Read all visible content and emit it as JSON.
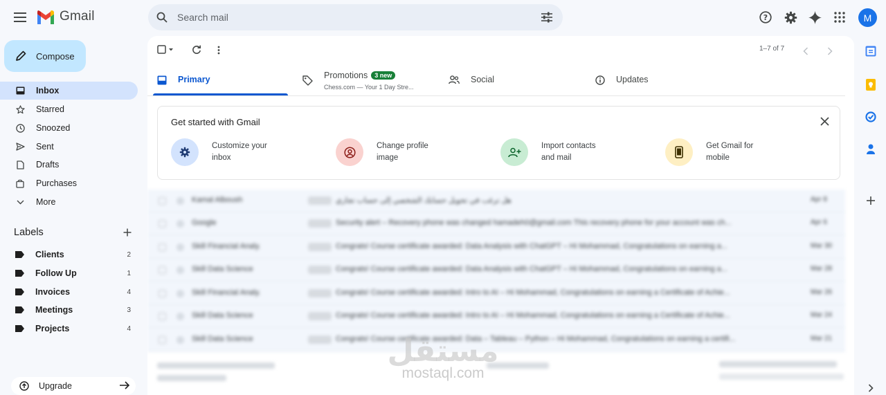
{
  "app": {
    "name": "Gmail",
    "avatar_letter": "M"
  },
  "search": {
    "placeholder": "Search mail"
  },
  "compose": {
    "label": "Compose"
  },
  "nav": [
    {
      "label": "Inbox",
      "icon": "inbox-icon",
      "active": true
    },
    {
      "label": "Starred",
      "icon": "star-icon"
    },
    {
      "label": "Snoozed",
      "icon": "clock-icon"
    },
    {
      "label": "Sent",
      "icon": "send-icon"
    },
    {
      "label": "Drafts",
      "icon": "draft-icon"
    },
    {
      "label": "Purchases",
      "icon": "shopping-bag-icon"
    },
    {
      "label": "More",
      "icon": "chevron-down-icon"
    }
  ],
  "labels": {
    "title": "Labels",
    "items": [
      {
        "label": "Clients",
        "count": "2"
      },
      {
        "label": "Follow Up",
        "count": "1"
      },
      {
        "label": "Invoices",
        "count": "4"
      },
      {
        "label": "Meetings",
        "count": "3"
      },
      {
        "label": "Projects",
        "count": "4"
      }
    ]
  },
  "upgrade": {
    "label": "Upgrade"
  },
  "toolbar": {
    "pagination": "1–7 of 7"
  },
  "tabs": {
    "primary": "Primary",
    "promotions": "Promotions",
    "promotions_badge": "3 new",
    "promotions_sub": "Chess.com — Your 1 Day Stre...",
    "social": "Social",
    "updates": "Updates"
  },
  "get_started": {
    "title": "Get started with Gmail",
    "items": [
      {
        "line1": "Customize your",
        "line2": "inbox",
        "icon": "gear-icon",
        "color": "#d3e3fd"
      },
      {
        "line1": "Change profile",
        "line2": "image",
        "icon": "profile-icon",
        "color": "#fad2cf"
      },
      {
        "line1": "Import contacts",
        "line2": "and mail",
        "icon": "add-contact-icon",
        "color": "#c8ecd3"
      },
      {
        "line1": "Get Gmail for",
        "line2": "mobile",
        "icon": "phone-icon",
        "color": "#feefc3"
      }
    ]
  },
  "emails": [
    {
      "sender": "Kamal Alboush",
      "snippet": "هل ترغب في تحويل حسابك الشخصي إلى حساب تجاري",
      "date": "Apr 8"
    },
    {
      "sender": "Google",
      "snippet": "Security alert – Recovery phone was changed hamadeh0@gmail.com This recovery phone for your account was ch...",
      "date": "Apr 6"
    },
    {
      "sender": "Skill Financial Analy.",
      "snippet": "Congrats! Course certificate awarded: Data Analysis with ChatGPT – Hi Mohammad, Congratulations on earning a...",
      "date": "Mar 30"
    },
    {
      "sender": "Skill Data Science",
      "snippet": "Congrats! Course certificate awarded: Data Analysis with ChatGPT – Hi Mohammad, Congratulations on earning a...",
      "date": "Mar 28"
    },
    {
      "sender": "Skill Financial Analy.",
      "snippet": "Congrats! Course certificate awarded: Intro to AI – Hi Mohammad, Congratulations on earning a Certificate of Achie...",
      "date": "Mar 26"
    },
    {
      "sender": "Skill Data Science",
      "snippet": "Congrats! Course certificate awarded: Intro to AI – Hi Mohammad, Congratulations on earning a Certificate of Achie...",
      "date": "Mar 24"
    },
    {
      "sender": "Skill Data Science",
      "snippet": "Congrats! Course certificate awarded: Data – Tableau – Python – Hi Mohammad, Congratulations on earning a certifi...",
      "date": "Mar 21"
    }
  ],
  "watermark": {
    "logo": "مستقل",
    "url": "mostaql.com"
  },
  "colors": {
    "accent": "#0b57d0",
    "compose_bg": "#c2e7ff",
    "active_nav": "#d3e3fd",
    "badge_green": "#188038"
  }
}
